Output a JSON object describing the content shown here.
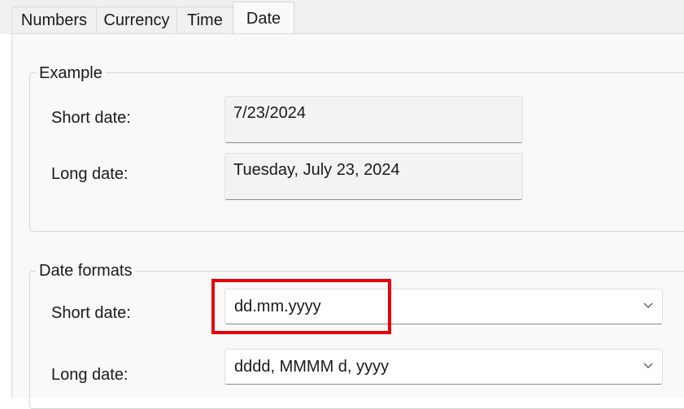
{
  "tabs": [
    {
      "label": "Numbers"
    },
    {
      "label": "Currency"
    },
    {
      "label": "Time"
    },
    {
      "label": "Date"
    }
  ],
  "selected_tab": "Date",
  "example": {
    "title": "Example",
    "short_date_label": "Short date:",
    "short_date_value": "7/23/2024",
    "long_date_label": "Long date:",
    "long_date_value": "Tuesday, July 23, 2024"
  },
  "date_formats": {
    "title": "Date formats",
    "short_date_label": "Short date:",
    "short_date_value": "dd.mm.yyyy",
    "long_date_label": "Long date:",
    "long_date_value": "dddd, MMMM d, yyyy"
  },
  "colors": {
    "highlight": "#e8000b",
    "panel_bg": "#f9f9f9",
    "tabstrip_bg": "#f0f0f0"
  },
  "icons": {
    "dropdown": "chevron-down-icon"
  }
}
